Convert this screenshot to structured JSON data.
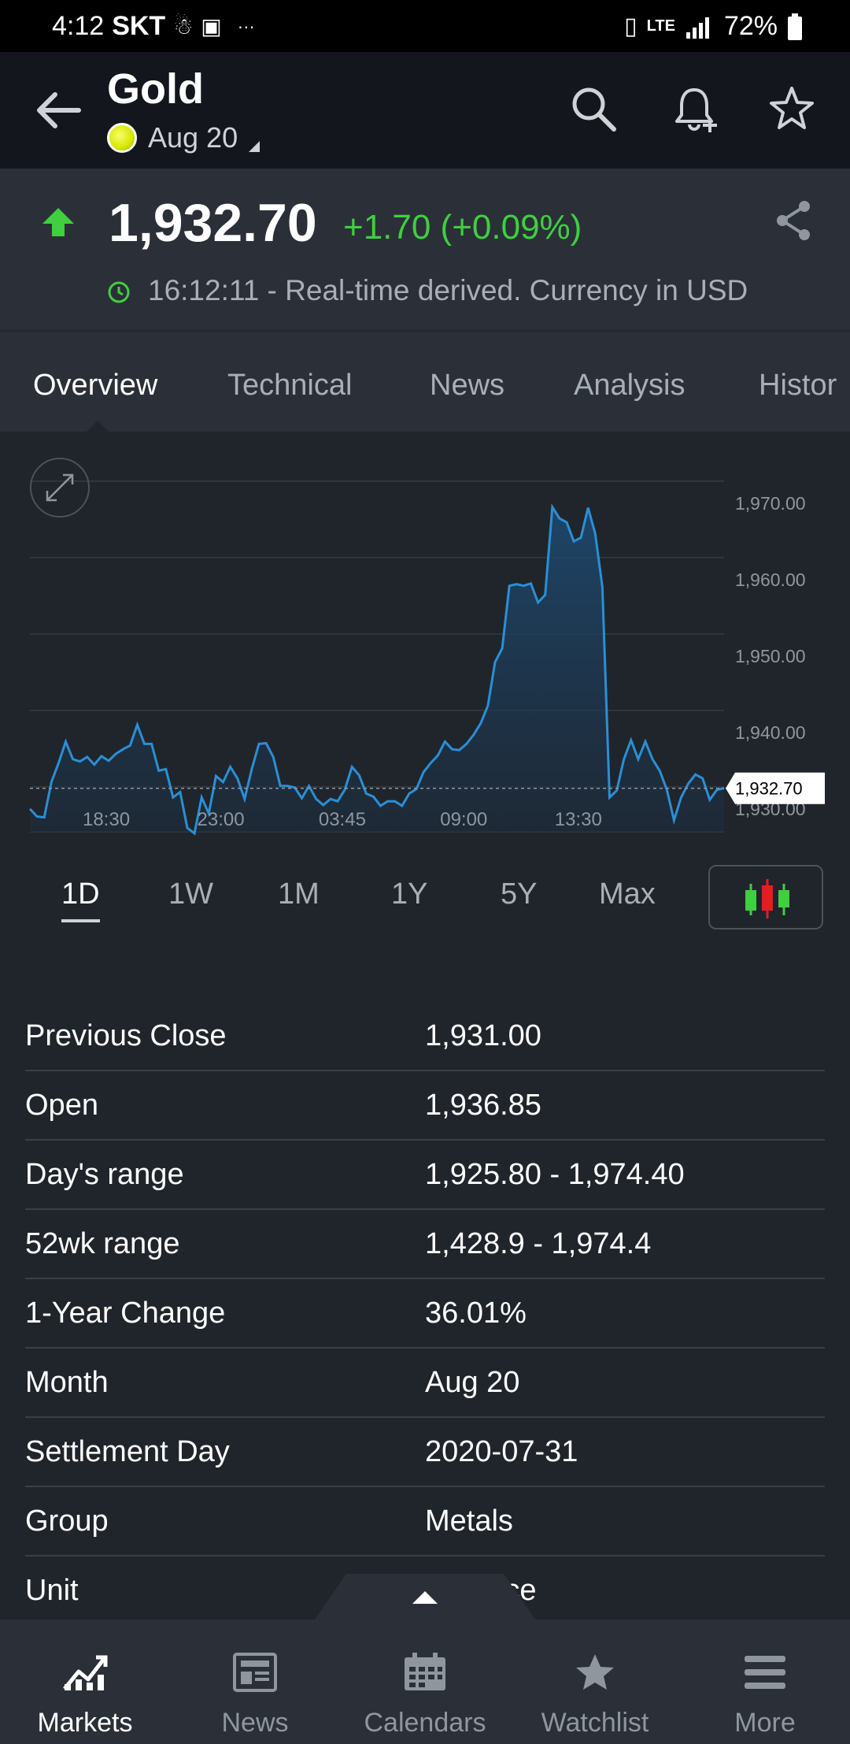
{
  "status_bar": {
    "time": "4:12",
    "carrier": "SKT",
    "dots": "···",
    "battery": "72%"
  },
  "header": {
    "title": "Gold",
    "contract": "Aug 20"
  },
  "quote": {
    "price": "1,932.70",
    "change": "+1.70 (+0.09%)",
    "timestamp": "16:12:11 - Real-time derived. Currency in USD",
    "colors": {
      "up": "#3fcf3f",
      "line": "#2a8fd6"
    }
  },
  "tabs": [
    "Overview",
    "Technical",
    "News",
    "Analysis",
    "Histor"
  ],
  "chart_data": {
    "type": "area",
    "x_ticks": [
      "18:30",
      "23:00",
      "03:45",
      "09:00",
      "13:30"
    ],
    "y_ticks": [
      "1,970.00",
      "1,960.00",
      "1,950.00",
      "1,940.00",
      "1,930.00"
    ],
    "ylim": [
      1927,
      1974
    ],
    "last_price_label": "1,932.70",
    "last_price": 1932.7,
    "values": [
      1930.0,
      1929.0,
      1928.9,
      1933.5,
      1936.0,
      1938.8,
      1936.5,
      1936.2,
      1936.8,
      1935.8,
      1936.9,
      1936.3,
      1937.2,
      1937.8,
      1938.3,
      1941.0,
      1938.5,
      1938.5,
      1935.0,
      1935.2,
      1931.5,
      1932.2,
      1927.5,
      1926.8,
      1931.5,
      1929.4,
      1934.3,
      1933.5,
      1935.5,
      1934.0,
      1931.3,
      1935.2,
      1938.5,
      1938.6,
      1936.8,
      1933.0,
      1933.0,
      1932.8,
      1931.4,
      1933.0,
      1931.3,
      1930.5,
      1931.3,
      1931.0,
      1932.5,
      1935.5,
      1934.4,
      1932.0,
      1931.6,
      1930.4,
      1931.0,
      1931.0,
      1930.4,
      1932.0,
      1932.6,
      1934.8,
      1936.0,
      1937.0,
      1938.8,
      1937.8,
      1937.7,
      1938.5,
      1939.7,
      1941.2,
      1943.5,
      1949.2,
      1951.0,
      1959.2,
      1959.4,
      1959.2,
      1959.5,
      1957.0,
      1958.0,
      1969.5,
      1968.0,
      1967.5,
      1965.0,
      1965.5,
      1969.4,
      1966.0,
      1959.0,
      1931.5,
      1932.4,
      1936.5,
      1939.0,
      1936.5,
      1938.8,
      1936.5,
      1935.0,
      1932.5,
      1928.5,
      1931.5,
      1933.3,
      1934.5,
      1934.0,
      1931.2,
      1932.5,
      1932.7
    ]
  },
  "ranges": [
    "1D",
    "1W",
    "1M",
    "1Y",
    "5Y",
    "Max"
  ],
  "active_range": "1D",
  "stats": [
    {
      "label": "Previous Close",
      "value": "1,931.00"
    },
    {
      "label": "Open",
      "value": "1,936.85"
    },
    {
      "label": "Day's range",
      "value": "1,925.80 - 1,974.40"
    },
    {
      "label": "52wk range",
      "value": "1,428.9 - 1,974.4"
    },
    {
      "label": "1-Year Change",
      "value": "36.01%"
    },
    {
      "label": "Month",
      "value": "Aug 20"
    },
    {
      "label": "Settlement Day",
      "value": "2020-07-31"
    },
    {
      "label": "Group",
      "value": "Metals"
    },
    {
      "label": "Unit",
      "value": "y Ounce"
    }
  ],
  "bottom_nav": [
    "Markets",
    "News",
    "Calendars",
    "Watchlist",
    "More"
  ],
  "active_nav": "Markets"
}
